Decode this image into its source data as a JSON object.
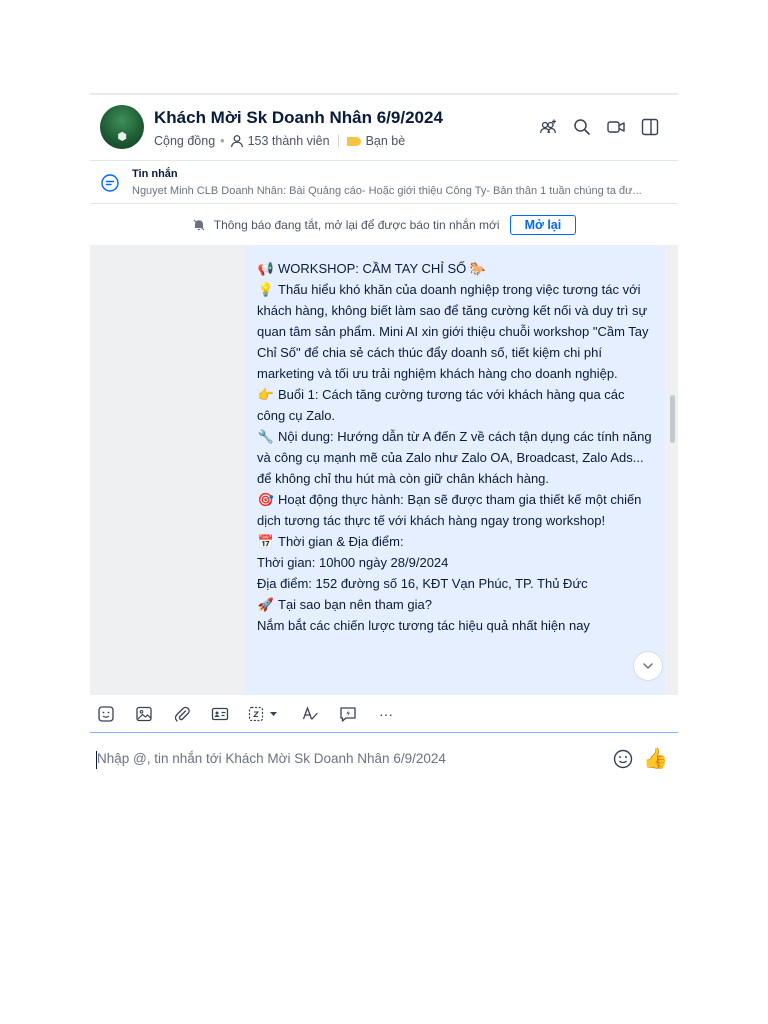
{
  "header": {
    "title": "Khách Mời Sk Doanh Nhân 6/9/2024",
    "group_type": "Cộng đồng",
    "member_count": "153 thành viên",
    "tag": "Bạn bè",
    "tag_color": "#f6c343",
    "icons": [
      "add-member-icon",
      "search-icon",
      "video-call-icon",
      "sidebar-toggle-icon"
    ]
  },
  "pinned": {
    "title": "Tin nhắn",
    "preview": "Nguyet Minh CLB Doanh Nhân: Bài Quảng cáo- Hoặc giới thiệu Công Ty- Bản thân 1 tuần chúng ta đư..."
  },
  "notify": {
    "text": "Thông báo đang tắt, mở lại để được báo tin nhắn mới",
    "button": "Mở lại"
  },
  "message": {
    "lines": [
      {
        "emoji": "📢",
        "text": "WORKSHOP: CẦM TAY CHỈ SỐ 🐎"
      },
      {
        "emoji": "💡",
        "text": "Thấu hiểu khó khăn của doanh nghiệp trong việc tương tác với khách hàng, không biết làm sao để tăng cường kết nối và duy trì sự quan tâm sản phẩm. Mini AI xin giới thiệu chuỗi workshop \"Cầm Tay Chỉ Số\" để chia sẻ cách thúc đẩy doanh số, tiết kiệm chi phí marketing và tối ưu trải nghiệm khách hàng cho doanh nghiệp."
      },
      {
        "emoji": "👉",
        "text": "Buổi 1: Cách tăng cường tương tác với khách hàng qua các công cụ Zalo."
      },
      {
        "emoji": "🔧",
        "text": "Nội dung: Hướng dẫn từ A đến Z về cách tận dụng các tính năng và công cụ mạnh mẽ của Zalo như Zalo OA, Broadcast, Zalo Ads... để không chỉ thu hút mà còn giữ chân khách hàng."
      },
      {
        "emoji": "🎯",
        "text": "Hoạt động thực hành: Bạn sẽ được tham gia thiết kế một chiến dịch tương tác thực tế với khách hàng ngay trong workshop!"
      },
      {
        "emoji": "📅",
        "text": "Thời gian & Địa điểm:"
      },
      {
        "emoji": "",
        "text": "Thời gian: 10h00 ngày 28/9/2024"
      },
      {
        "emoji": "",
        "text": "Địa điểm: 152 đường số 16, KĐT Vạn Phúc, TP. Thủ Đức"
      },
      {
        "emoji": "🚀",
        "text": "Tại sao bạn nên tham gia?"
      },
      {
        "emoji": "",
        "text": "Nắm bắt các chiến lược tương tác hiệu quả nhất hiện nay"
      }
    ]
  },
  "toolbar": {
    "icons": [
      "sticker-icon",
      "image-icon",
      "attachment-icon",
      "contact-card-icon",
      "screenshot-icon",
      "text-format-icon",
      "quick-message-icon",
      "more-icon"
    ],
    "more_label": "···"
  },
  "composer": {
    "placeholder": "Nhập @, tin nhắn tới Khách Mời Sk Doanh Nhân 6/9/2024",
    "like_emoji": "👍"
  }
}
